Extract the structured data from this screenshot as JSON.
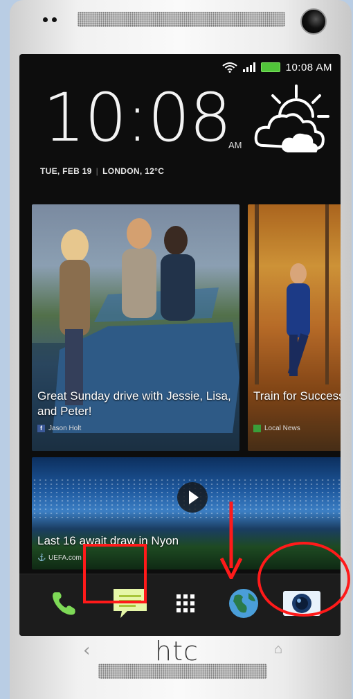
{
  "status_bar": {
    "time": "10:08 AM",
    "icons": [
      "wifi-icon",
      "signal-icon",
      "battery-icon"
    ],
    "battery_color": "#51c53a"
  },
  "clock": {
    "time": "10:08",
    "ampm": "AM",
    "date": "TUE, FEB 19",
    "location_temp": "LONDON, 12°C",
    "weather_icon": "partly-cloudy-icon"
  },
  "feed": {
    "tiles": [
      {
        "caption": "Great Sunday drive with Jessie, Lisa, and Peter!",
        "source": "Jason Holt",
        "source_icon": "facebook-icon"
      },
      {
        "caption": "Train for Success",
        "source": "Local News",
        "source_icon": "news-icon"
      },
      {
        "caption": "Last 16 await draw in Nyon",
        "source": "UEFA.com",
        "source_icon": "uefa-icon",
        "media": "video-play-icon"
      }
    ]
  },
  "dock": {
    "apps": [
      "phone-icon",
      "messages-icon",
      "apps-grid-icon",
      "browser-icon",
      "camera-app-icon"
    ]
  },
  "hardware": {
    "brand": "htc",
    "nav": [
      "back-icon",
      "home-icon"
    ]
  },
  "annotation": {
    "color": "#ff1a1a"
  }
}
